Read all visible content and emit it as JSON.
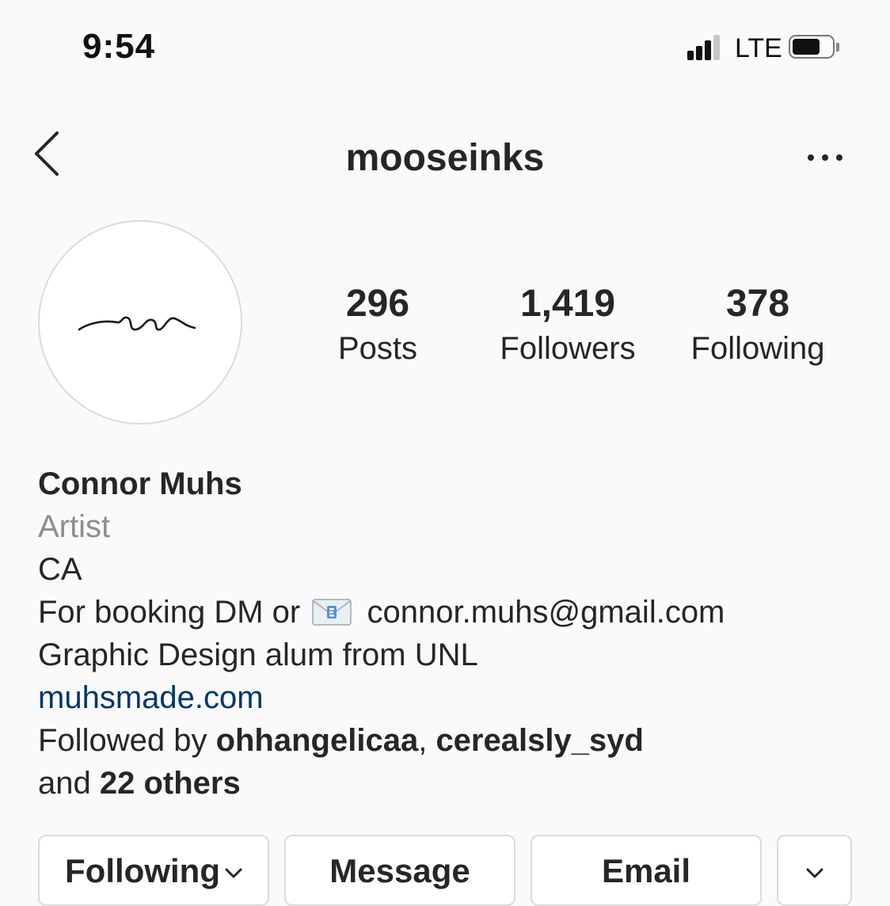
{
  "status_bar": {
    "time": "9:54",
    "network": "LTE",
    "signal_bars_lit": 3,
    "signal_bars_total": 4,
    "battery_level": 0.7
  },
  "nav": {
    "username": "mooseinks",
    "back_icon": "chevron-left-icon",
    "more_icon": "more-horizontal-icon"
  },
  "stats": {
    "posts": {
      "value": "296",
      "label": "Posts"
    },
    "followers": {
      "value": "1,419",
      "label": "Followers"
    },
    "following": {
      "value": "378",
      "label": "Following"
    }
  },
  "bio": {
    "name": "Connor Muhs",
    "category": "Artist",
    "location": "CA",
    "booking_prefix": "For booking DM or",
    "email": "connor.muhs@gmail.com",
    "education": "Graphic Design alum from UNL",
    "website": "muhsmade.com",
    "followed_by_prefix": "Followed by",
    "followed_by_user1": "ohhangelicaa",
    "followed_by_user2": "cerealsly_syd",
    "followed_by_and": "and",
    "followed_by_others": "22 others"
  },
  "actions": {
    "following": "Following",
    "message": "Message",
    "email": "Email"
  },
  "colors": {
    "background": "#fafafa",
    "text": "#262626",
    "secondary_text": "#8e8e8e",
    "link": "#00376b",
    "border": "#dbdbdb"
  }
}
